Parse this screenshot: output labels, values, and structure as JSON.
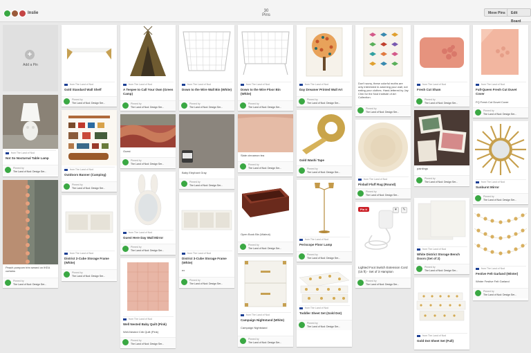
{
  "header": {
    "board_name": "Inslie",
    "pins_count": "30",
    "pins_label": "Pins",
    "move_pins": "Move Pins",
    "edit_board": "Edit Board"
  },
  "add_pin": {
    "label": "Add a Pin",
    "icon": "+"
  },
  "pinned_by": "Pinned by",
  "board_owner": "The Land of Nod: Design Ser...",
  "source": "from The Land of Nod",
  "pins": [
    {
      "title": "Gold Standard Wall Shelf"
    },
    {
      "title": "A Teepee to Call Your Own (Green Camp)"
    },
    {
      "title": "Down to the Wire Wall Bin (White)"
    },
    {
      "title": "Down to the Wire Floor Bin (White)"
    },
    {
      "title": "Day Dreamer Printed Wall Art"
    },
    {
      "description": "Don't worry, these colorful moths are only interested in adorning your wall, not eating your clothes. Hand-lettered by Jay Chin for the Nod Institute of Art Collection."
    },
    {
      "title": "Fresh Cut Sham"
    },
    {
      "title": "Full-Queen Fresh Cut Duvet Cover",
      "description": "FQ Fresh Cut Duvet Cover"
    },
    {
      "title": "Not So Nocturnal Table Lamp"
    },
    {
      "title": "Outdoors Banner (Camping)"
    },
    {
      "description": "Guest"
    },
    {
      "description": "Baby Elephant Gray"
    },
    {
      "description": "Slate cinnamon tea"
    },
    {
      "title": "Gold Washi Tape"
    },
    {
      "title": "Pinball Fluff Rug (Round)"
    },
    {
      "description": "paintings"
    },
    {
      "title": "Sunburst Mirror"
    },
    {
      "description": "Peach pompom trim sewed on IKEA curtains"
    },
    {
      "title": "District 2-Cube Storage Frame (White)"
    },
    {
      "title": "Guest Here Day Wall Mirror"
    },
    {
      "title": "District 3-Cube Storage Frame (White)",
      "description": "ex"
    },
    {
      "description": "Open Book Bin (Walnut)"
    },
    {
      "title": "Periscope Floor Lamp"
    },
    {
      "title": "Lighted Foot Switch Extension Cord (15 ft) - Set of 3 Hampton",
      "pin_it": "Pin it"
    },
    {
      "title": "White District Storage Bench Doors (Set of 2)"
    },
    {
      "title": "Festive Felt Garland (Winter)",
      "description": "Winter Festive Felt Garland"
    },
    {
      "title": "Well Nested Baby Quilt (Pink)",
      "description": "Well-Nested Crib Quilt (Pink)"
    },
    {
      "title": "Campaign Nightstand (White)",
      "description": "Campaign Nightstand"
    },
    {
      "title": "Toddler Sheet Set (Gold Dot)"
    },
    {
      "title": "Gold Dot Sheet Set (Full)"
    }
  ]
}
